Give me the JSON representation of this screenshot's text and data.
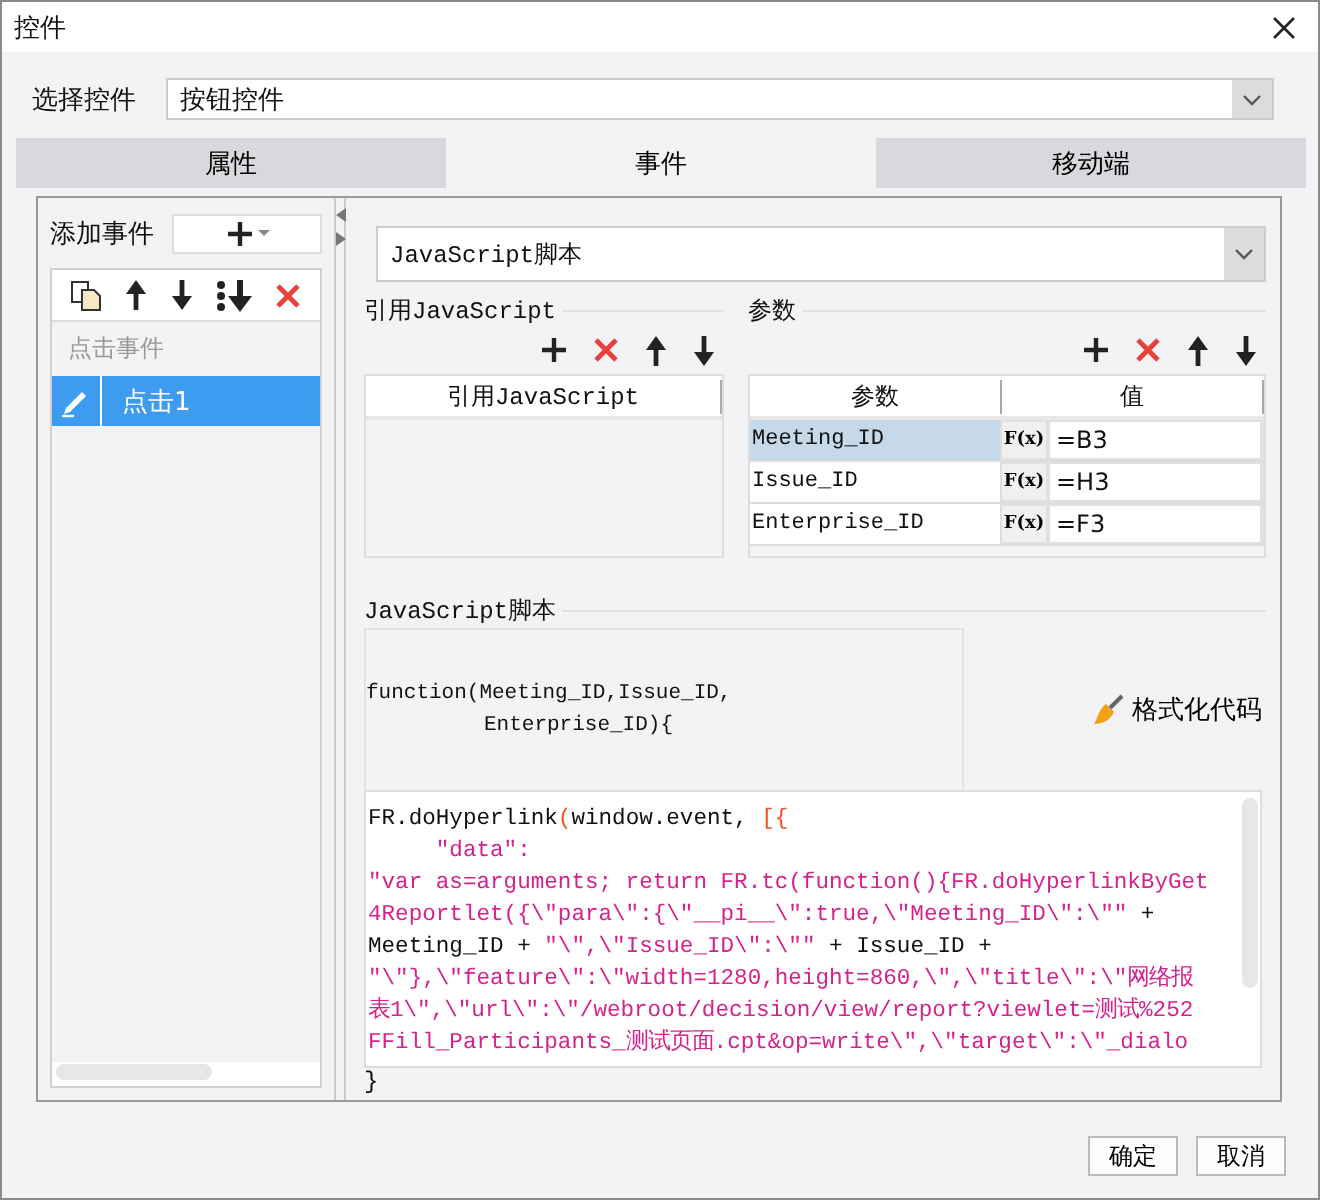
{
  "window": {
    "title": "控件"
  },
  "widget_select": {
    "label": "选择控件",
    "value": "按钮控件"
  },
  "tabs": [
    {
      "label": "属性",
      "selected": false
    },
    {
      "label": "事件",
      "selected": true
    },
    {
      "label": "移动端",
      "selected": false
    }
  ],
  "events": {
    "label": "添加事件",
    "group": "点击事件",
    "items": [
      {
        "label": "点击1",
        "selected": true
      }
    ]
  },
  "script_type": {
    "value": "JavaScript脚本"
  },
  "referenced_js": {
    "title": "引用JavaScript",
    "column": "引用JavaScript"
  },
  "parameters": {
    "title": "参数",
    "columns": [
      "参数",
      "值"
    ],
    "rows": [
      {
        "name": "Meeting_ID",
        "formula": "F(x)",
        "value": "=B3",
        "selected": true
      },
      {
        "name": "Issue_ID",
        "formula": "F(x)",
        "value": "=H3",
        "selected": false
      },
      {
        "name": "Enterprise_ID",
        "formula": "F(x)",
        "value": "=F3",
        "selected": false
      }
    ]
  },
  "script": {
    "title": "JavaScript脚本",
    "signature": [
      "function(Meeting_ID,Issue_ID,",
      "Enterprise_ID){"
    ],
    "format_button": "格式化代码",
    "lines": [
      [
        {
          "kind": "plain",
          "text": "FR.doHyperlink"
        },
        {
          "kind": "bracket",
          "text": "("
        },
        {
          "kind": "plain",
          "text": "window.event, "
        },
        {
          "kind": "bracket",
          "text": "[{"
        }
      ],
      [
        {
          "kind": "string",
          "text": "     \"data\":"
        }
      ],
      [
        {
          "kind": "string",
          "text": "\"var as=arguments; return FR.tc(function(){FR.doHyperlinkByGet"
        }
      ],
      [
        {
          "kind": "string",
          "text": "4Reportlet({\\\"para\\\":{\\\"__pi__\\\":true,\\\"Meeting_ID\\\":\\\"\""
        },
        {
          "kind": "plain",
          "text": " +"
        }
      ],
      [
        {
          "kind": "plain",
          "text": "Meeting_ID + "
        },
        {
          "kind": "string",
          "text": "\"\\\",\\\"Issue_ID\\\":\\\"\""
        },
        {
          "kind": "plain",
          "text": " + Issue_ID +"
        }
      ],
      [
        {
          "kind": "string",
          "text": "\"\\\"},\\\"feature\\\":\\\"width=1280,height=860,\\\",\\\"title\\\":\\\"网络报"
        }
      ],
      [
        {
          "kind": "string",
          "text": "表1\\\",\\\"url\\\":\\\"/webroot/decision/view/report?viewlet=测试%252"
        }
      ],
      [
        {
          "kind": "string",
          "text": "FFill_Participants_测试页面.cpt&op=write\\\",\\\"target\\\":\\\"_dialo"
        }
      ]
    ],
    "closing": "}"
  },
  "buttons": [
    "确定",
    "取消"
  ]
}
